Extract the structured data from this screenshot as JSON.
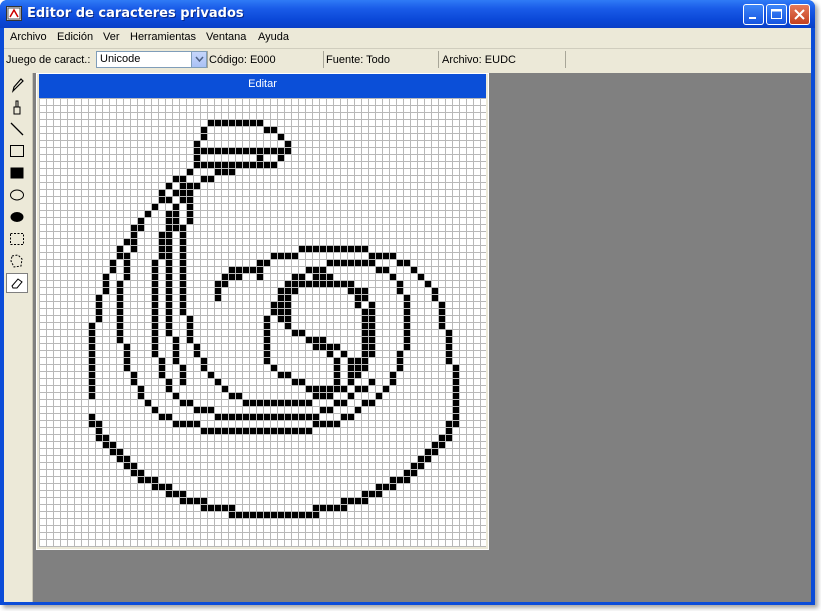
{
  "window": {
    "title": "Editor de caracteres privados"
  },
  "menubar": {
    "items": [
      "Archivo",
      "Edición",
      "Ver",
      "Herramientas",
      "Ventana",
      "Ayuda"
    ]
  },
  "toolbar": {
    "charset_label": "Juego de caract.:",
    "charset_value": "Unicode",
    "code": "Código: E000",
    "font": "Fuente: Todo",
    "file": "Archivo: EUDC"
  },
  "tools": [
    {
      "icon": "pencil-icon"
    },
    {
      "icon": "brush-icon"
    },
    {
      "icon": "line-icon"
    },
    {
      "icon": "hollow-rectangle-icon"
    },
    {
      "icon": "filled-rectangle-icon"
    },
    {
      "icon": "hollow-ellipse-icon"
    },
    {
      "icon": "filled-ellipse-icon"
    },
    {
      "icon": "rectangular-selection-icon"
    },
    {
      "icon": "freeform-selection-icon"
    },
    {
      "icon": "eraser-icon",
      "selected": true
    }
  ],
  "editor": {
    "title": "Editar"
  },
  "colors": {
    "title_bar": "#0b4cd8",
    "child_title": "#0b4fd8",
    "workspace": "#808080",
    "grid_line": "#b8b8b8",
    "ink": "#000000"
  }
}
